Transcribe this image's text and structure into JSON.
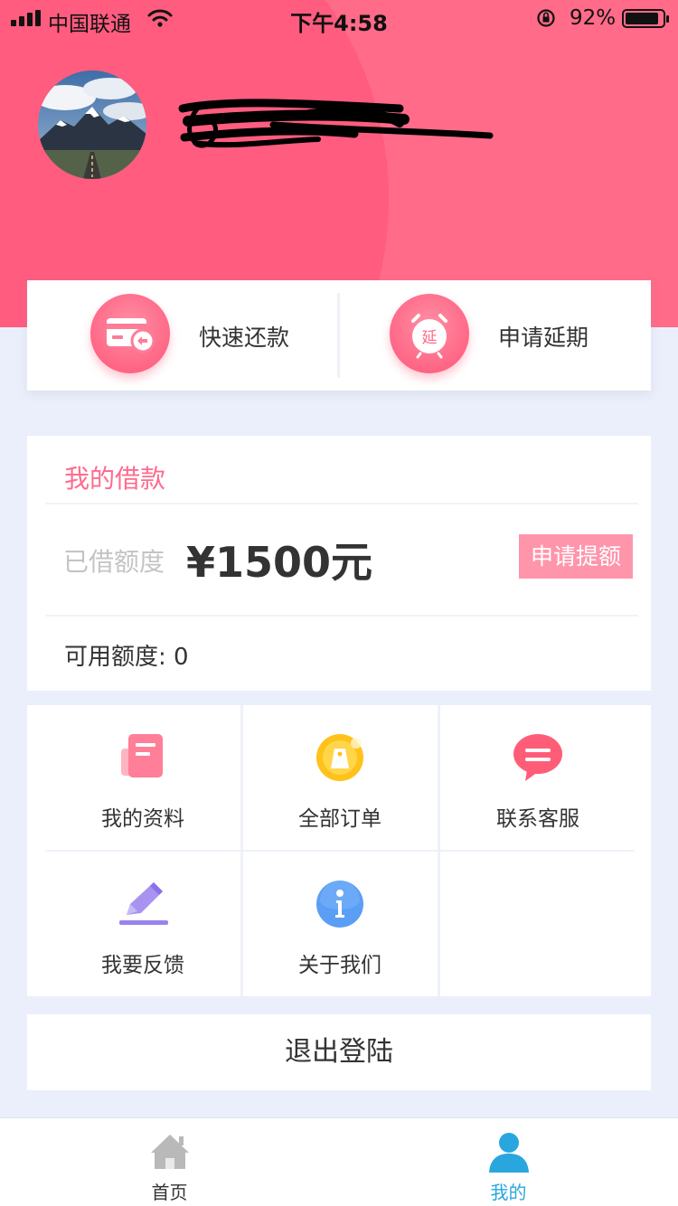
{
  "status_bar": {
    "carrier": "中国联通",
    "time": "下午4:58",
    "battery_percent": "92%",
    "battery_level": 0.92
  },
  "quick_actions": [
    {
      "label": "快速还款",
      "icon": "repay-card-icon"
    },
    {
      "label": "申请延期",
      "icon": "alarm-clock-extend-icon",
      "icon_text": "延"
    }
  ],
  "loan": {
    "title": "我的借款",
    "borrowed_label": "已借额度",
    "borrowed_amount": "¥1500元",
    "raise_button": "申请提额",
    "available": "可用额度: 0"
  },
  "menu": [
    {
      "label": "我的资料",
      "icon": "profile-document-icon"
    },
    {
      "label": "全部订单",
      "icon": "order-tag-icon"
    },
    {
      "label": "联系客服",
      "icon": "chat-bubble-icon"
    },
    {
      "label": "我要反馈",
      "icon": "pencil-feedback-icon"
    },
    {
      "label": "关于我们",
      "icon": "info-icon"
    }
  ],
  "logout_label": "退出登陆",
  "tabs": [
    {
      "label": "首页",
      "icon": "home-icon",
      "active": false
    },
    {
      "label": "我的",
      "icon": "user-icon",
      "active": true
    }
  ],
  "colors": {
    "brand_pink": "#ff6b88",
    "accent_pink_light": "#ff95ab",
    "title_pink": "#ff6b8e",
    "page_background": "#ebeffb",
    "tab_active": "#2aa6de",
    "tab_inactive": "#333333"
  }
}
